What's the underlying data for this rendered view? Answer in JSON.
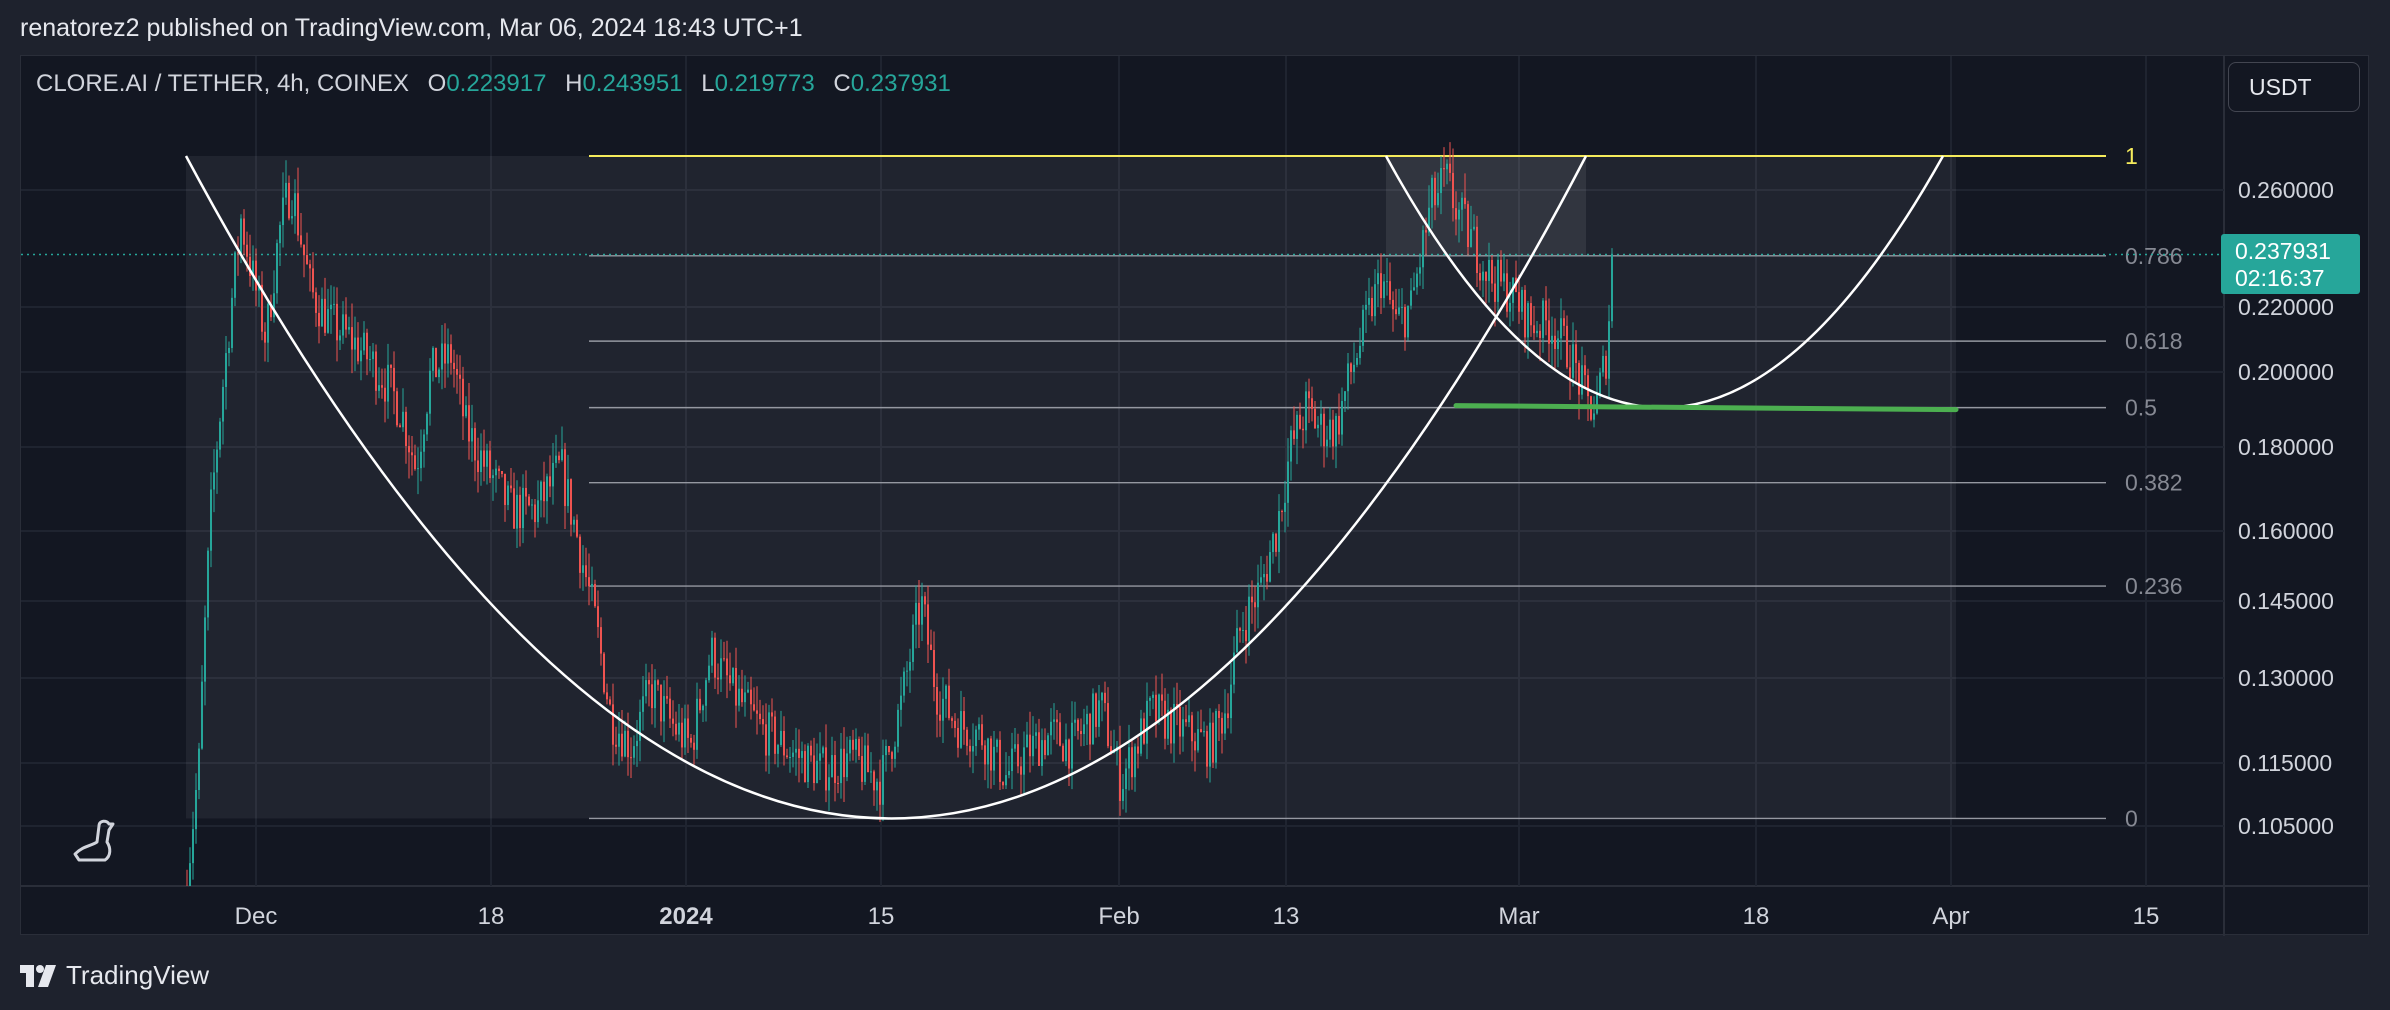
{
  "caption": "renatorez2 published on TradingView.com, Mar 06, 2024 18:43 UTC+1",
  "symbol": {
    "name": "CLORE.AI / TETHER, 4h, COINEX",
    "open_label": "O",
    "open": "0.223917",
    "high_label": "H",
    "high": "0.243951",
    "low_label": "L",
    "low": "0.219773",
    "close_label": "C",
    "close": "0.237931"
  },
  "currency_button": "USDT",
  "last_price": {
    "price": "0.237931",
    "countdown": "02:16:37"
  },
  "footer_brand": "TradingView",
  "colors": {
    "up": "#26a69a",
    "down": "#ef5350",
    "fib_top": "#f5eb5c",
    "support": "#4caf50",
    "background": "#131722",
    "panel": "#1e222d"
  },
  "chart_data": {
    "type": "candlestick",
    "interval": "4h",
    "x_ticks": [
      {
        "label": "Dec"
      },
      {
        "label": "18"
      },
      {
        "label": "2024",
        "bold": true
      },
      {
        "label": "15"
      },
      {
        "label": "Feb"
      },
      {
        "label": "13"
      },
      {
        "label": "Mar"
      },
      {
        "label": "18"
      },
      {
        "label": "Apr"
      },
      {
        "label": "15"
      }
    ],
    "y_ticks": [
      "0.260000",
      "0.220000",
      "0.200000",
      "0.180000",
      "0.160000",
      "0.145000",
      "0.130000",
      "0.115000",
      "0.105000"
    ],
    "fib_levels": [
      {
        "label": "1",
        "value": 0.2705
      },
      {
        "label": "0.786",
        "value": 0.2375
      },
      {
        "label": "0.618",
        "value": 0.2095
      },
      {
        "label": "0.5",
        "value": 0.1905
      },
      {
        "label": "0.382",
        "value": 0.1715
      },
      {
        "label": "0.236",
        "value": 0.1482
      },
      {
        "label": "0",
        "value": 0.1062
      }
    ],
    "support_line": {
      "value": 0.1905
    },
    "drawings": [
      "cup-and-handle parabola (large)",
      "cup-and-handle parabola (handle)"
    ]
  }
}
